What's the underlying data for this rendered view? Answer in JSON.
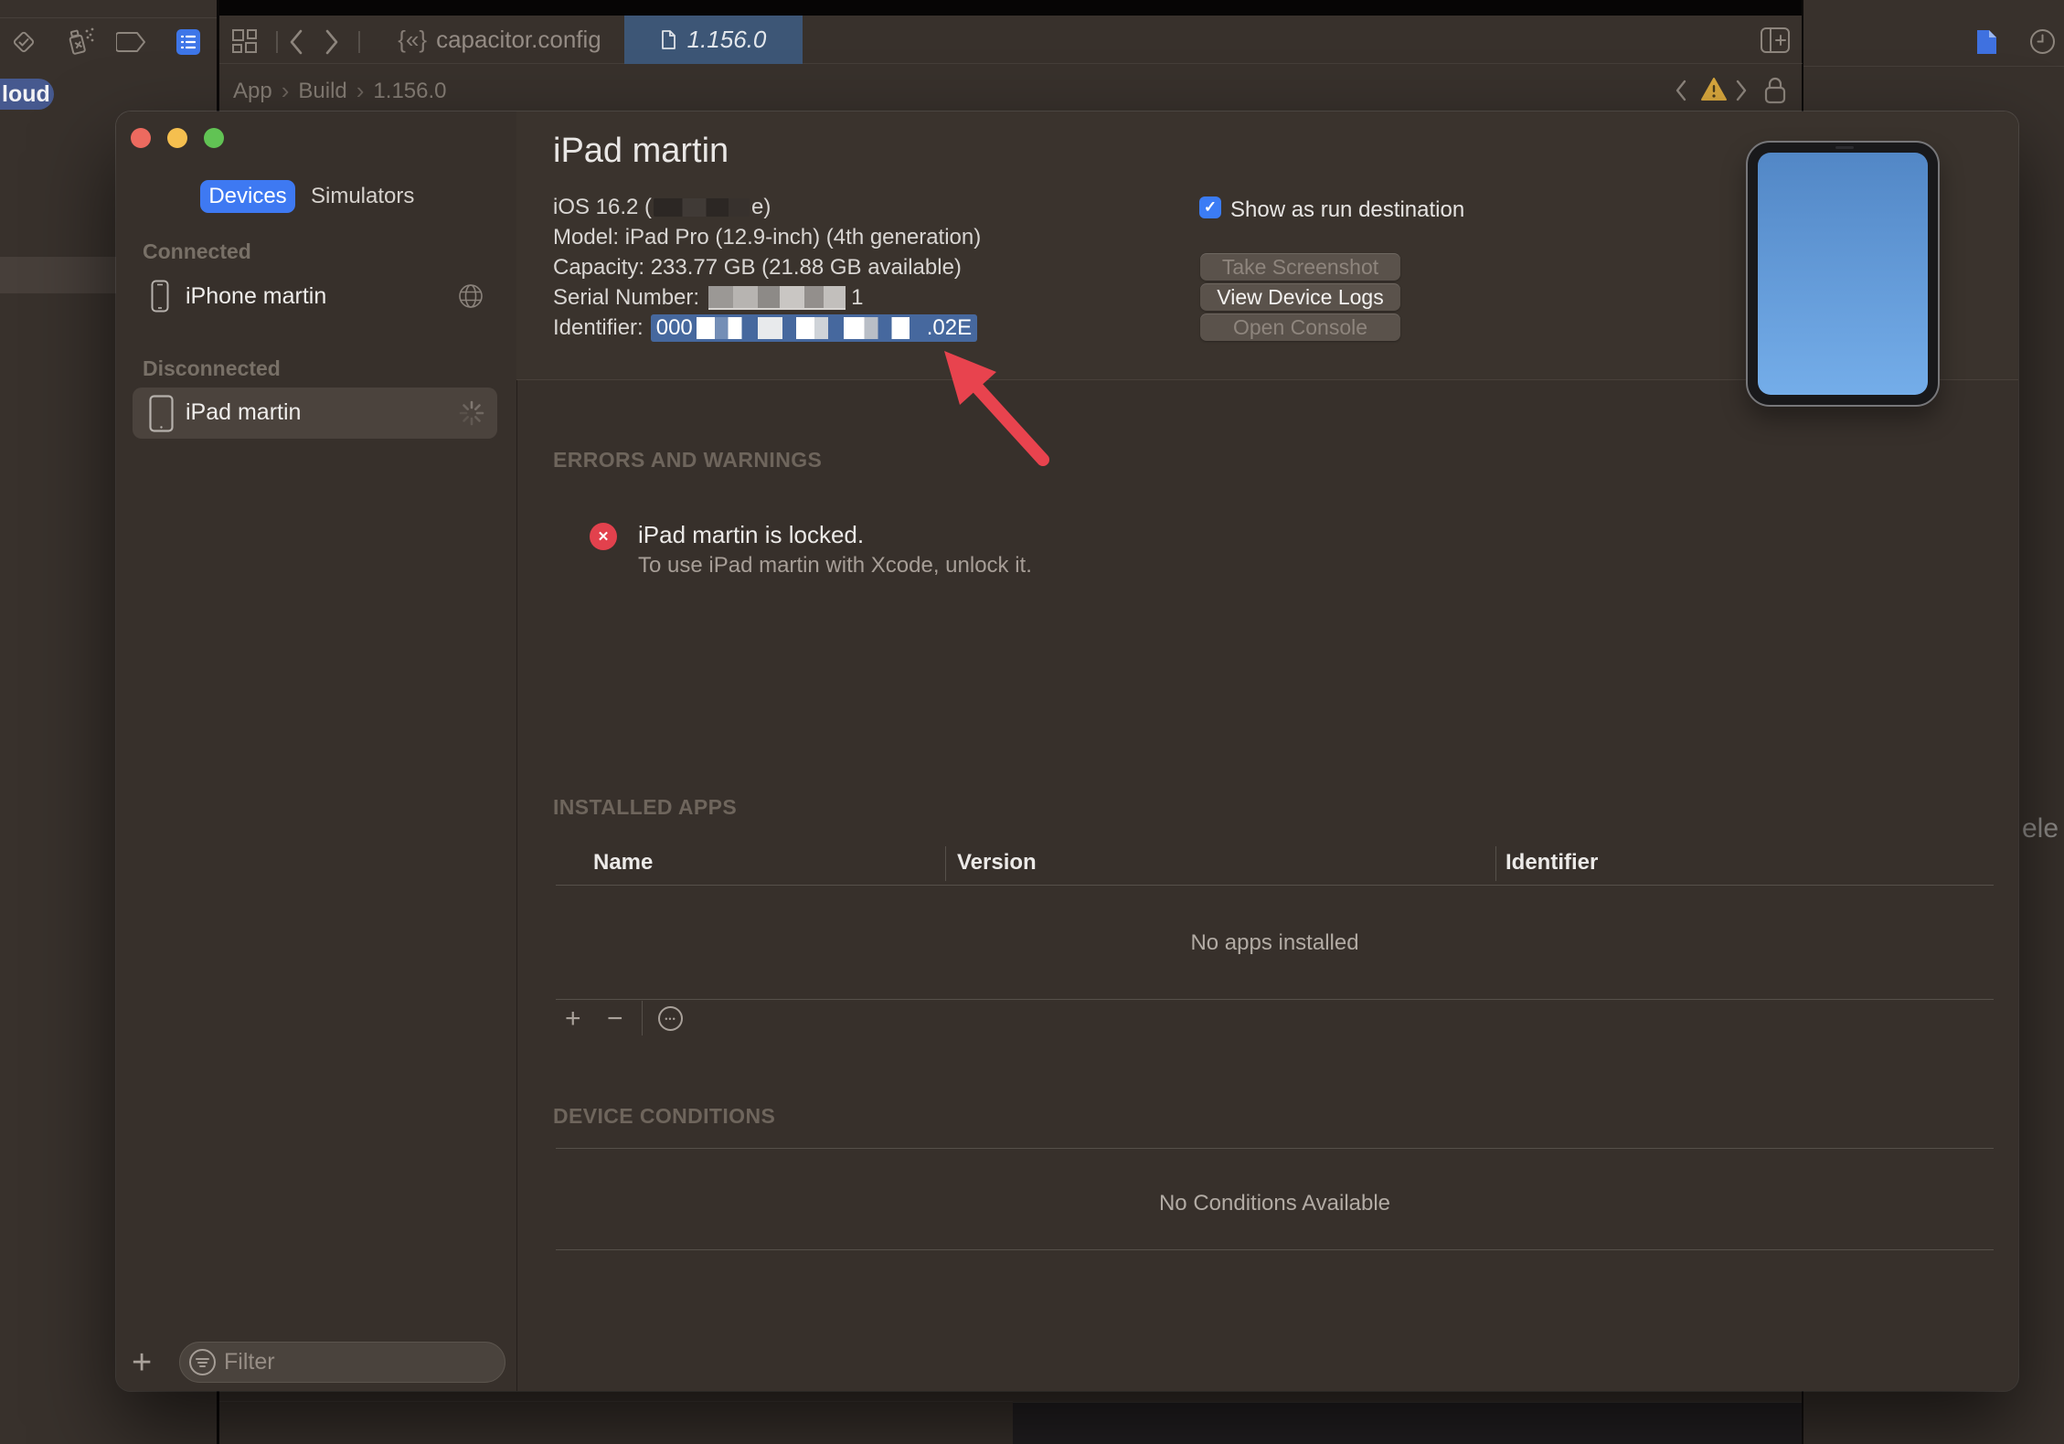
{
  "colors": {
    "desktop-bg": "#38312c",
    "window-bg": "#37302b",
    "header-bg": "#3a332d",
    "body-bg": "#362f2a",
    "sidebar-sel": "#4b433d",
    "accent-blue": "#3e79f2",
    "tab-blue": "#3d5676",
    "highlight-blue": "#46689e",
    "badge-blue": "#46598f",
    "btn-bg": "#5a524b",
    "error-red": "#e2414d",
    "arrow-red": "#e8434e",
    "screen-top": "#5287c6",
    "screen-bottom": "#74ade9",
    "text-primary": "#eceae8",
    "text-secondary": "#a79e97",
    "text-muted": "#6e655c",
    "icon-gray": "#8d857d",
    "hairline": "#56504a",
    "warning-yellow": "#d8a73d"
  },
  "chrome": {
    "tab_inactive": "capacitor.config",
    "tab_inactive_icon": "{«}",
    "tab_active": "1.156.0",
    "breadcrumb": [
      "App",
      "Build",
      "1.156.0"
    ],
    "cloud_badge": "loud",
    "right_partial_text": "ele"
  },
  "window": {
    "segmented": {
      "devices": "Devices",
      "simulators": "Simulators"
    },
    "sidebar": {
      "connected_header": "Connected",
      "disconnected_header": "Disconnected",
      "iphone_name": "iPhone martin",
      "ipad_name": "iPad martin",
      "filter_placeholder": "Filter",
      "add_label": "+"
    },
    "detail": {
      "title": "iPad martin",
      "os_prefix": "iOS 16.2 (",
      "os_suffix": "e)",
      "model": "Model: iPad Pro (12.9-inch) (4th generation)",
      "capacity": "Capacity: 233.77 GB (21.88 GB available)",
      "serial_label": "Serial Number:",
      "serial_visible": "1",
      "identifier_label": "Identifier:",
      "identifier_prefix": "000",
      "identifier_suffix": ".02E",
      "run_destination_label": "Show as run destination",
      "checkmark": "✓",
      "buttons": [
        {
          "label": "Take Screenshot",
          "enabled": false
        },
        {
          "label": "View Device Logs",
          "enabled": true
        },
        {
          "label": "Open Console",
          "enabled": false
        }
      ]
    },
    "errors": {
      "heading": "ERRORS AND WARNINGS",
      "icon_glyph": "✕",
      "title": "iPad martin is locked.",
      "detail": "To use iPad martin with Xcode, unlock it."
    },
    "installed_apps": {
      "heading": "INSTALLED APPS",
      "columns": [
        "Name",
        "Version",
        "Identifier"
      ],
      "empty": "No apps installed",
      "add": "+",
      "remove": "−",
      "more": "•••"
    },
    "device_conditions": {
      "heading": "DEVICE CONDITIONS",
      "empty": "No Conditions Available"
    }
  }
}
